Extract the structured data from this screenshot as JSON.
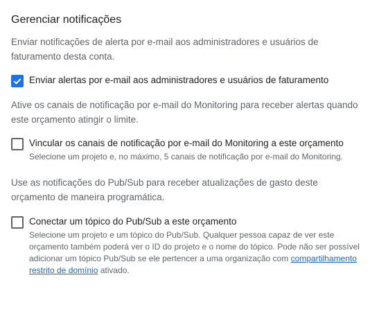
{
  "section": {
    "title": "Gerenciar notificações",
    "description": "Enviar notificações de alerta por e-mail aos administradores e usuários de faturamento desta conta."
  },
  "email_alerts": {
    "label": "Enviar alertas por e-mail aos administradores e usuários de faturamento",
    "checked": true
  },
  "monitoring": {
    "description": "Ative os canais de notificação por e-mail do Monitoring para receber alertas quando este orçamento atingir o limite.",
    "label": "Vincular os canais de notificação por e-mail do Monitoring a este orçamento",
    "sub": "Selecione um projeto e, no máximo, 5 canais de notificação por e-mail do Monitoring.",
    "checked": false
  },
  "pubsub": {
    "description": "Use as notificações do Pub/Sub para receber atualizações de gasto deste orçamento de maneira programática.",
    "label": "Conectar um tópico do Pub/Sub a este orçamento",
    "sub_before": "Selecione um projeto e um tópico do Pub/Sub. Qualquer pessoa capaz de ver este orçamento também poderá ver o ID do projeto e o nome do tópico. Pode não ser possível adicionar um tópico Pub/Sub se ele pertencer a uma organização com ",
    "sub_link": "compartilhamento restrito de domínio",
    "sub_after": " ativado.",
    "checked": false
  },
  "colors": {
    "accent": "#1a73e8",
    "link": "#1967d2"
  }
}
